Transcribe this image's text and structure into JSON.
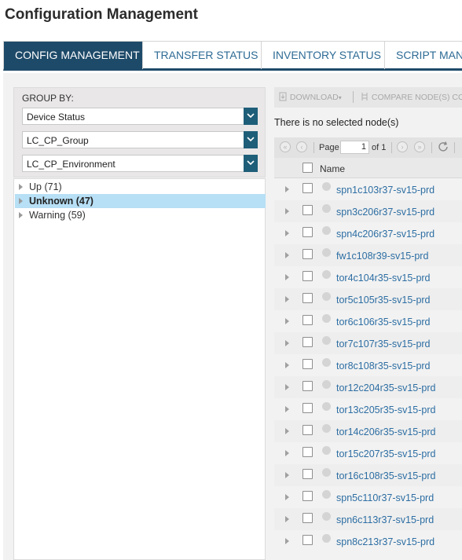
{
  "page_title": "Configuration Management",
  "tabs": [
    {
      "label": "CONFIG MANAGEMENT",
      "active": true
    },
    {
      "label": "TRANSFER STATUS",
      "active": false
    },
    {
      "label": "INVENTORY STATUS",
      "active": false
    },
    {
      "label": "SCRIPT MANA",
      "active": false
    }
  ],
  "group_by": {
    "label": "GROUP BY:",
    "selects": [
      "Device Status",
      "LC_CP_Group",
      "LC_CP_Environment"
    ]
  },
  "tree": [
    {
      "label": "Up (71)",
      "selected": false
    },
    {
      "label": "Unknown (47)",
      "selected": true
    },
    {
      "label": "Warning (59)",
      "selected": false
    }
  ],
  "toolbar": {
    "download": "DOWNLOAD",
    "compare": "COMPARE NODE(S) CO"
  },
  "no_selection": "There is no selected node(s)",
  "pager": {
    "page_label": "Page",
    "page_value": "1",
    "of_label": "of 1"
  },
  "grid": {
    "name_header": "Name",
    "rows": [
      "spn1c103r37-sv15-prd",
      "spn3c206r37-sv15-prd",
      "spn4c206r37-sv15-prd",
      "fw1c108r39-sv15-prd",
      "tor4c104r35-sv15-prd",
      "tor5c105r35-sv15-prd",
      "tor6c106r35-sv15-prd",
      "tor7c107r35-sv15-prd",
      "tor8c108r35-sv15-prd",
      "tor12c204r35-sv15-prd",
      "tor13c205r35-sv15-prd",
      "tor14c206r35-sv15-prd",
      "tor15c207r35-sv15-prd",
      "tor16c108r35-sv15-prd",
      "spn5c110r37-sv15-prd",
      "spn6c113r37-sv15-prd",
      "spn8c213r37-sv15-prd"
    ]
  },
  "colors": {
    "accent": "#1e4a69",
    "link": "#2d6ea3",
    "selected_row": "#b7dff5"
  }
}
